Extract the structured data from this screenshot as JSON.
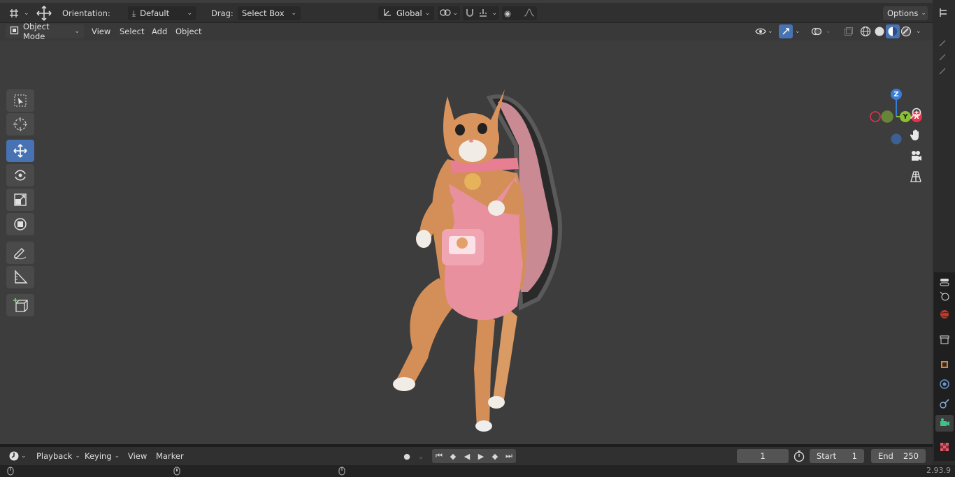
{
  "header": {
    "orientation_label": "Orientation:",
    "orientation_value": "Default",
    "drag_label": "Drag:",
    "drag_value": "Select Box",
    "transform_space": "Global",
    "options_label": "Options"
  },
  "viewport_header": {
    "mode": "Object Mode",
    "menus": [
      "View",
      "Select",
      "Add",
      "Object"
    ]
  },
  "toolbar": {
    "tools": [
      "select-box",
      "cursor",
      "move",
      "rotate",
      "scale",
      "transform",
      "annotate",
      "measure",
      "add-cube"
    ],
    "active_tool": "move"
  },
  "gizmo": {
    "z": "Z",
    "x": "X",
    "y": "Y"
  },
  "timeline": {
    "menus": [
      "Playback",
      "Keying",
      "View",
      "Marker"
    ],
    "current_frame": "1",
    "start_label": "Start",
    "start_value": "1",
    "end_label": "End",
    "end_value": "250"
  },
  "status": {
    "version": "2.93.9"
  },
  "colors": {
    "accent": "#4772b3",
    "axis_x": "#e8324a",
    "axis_y": "#8bc034",
    "axis_z": "#3a7dd6"
  }
}
